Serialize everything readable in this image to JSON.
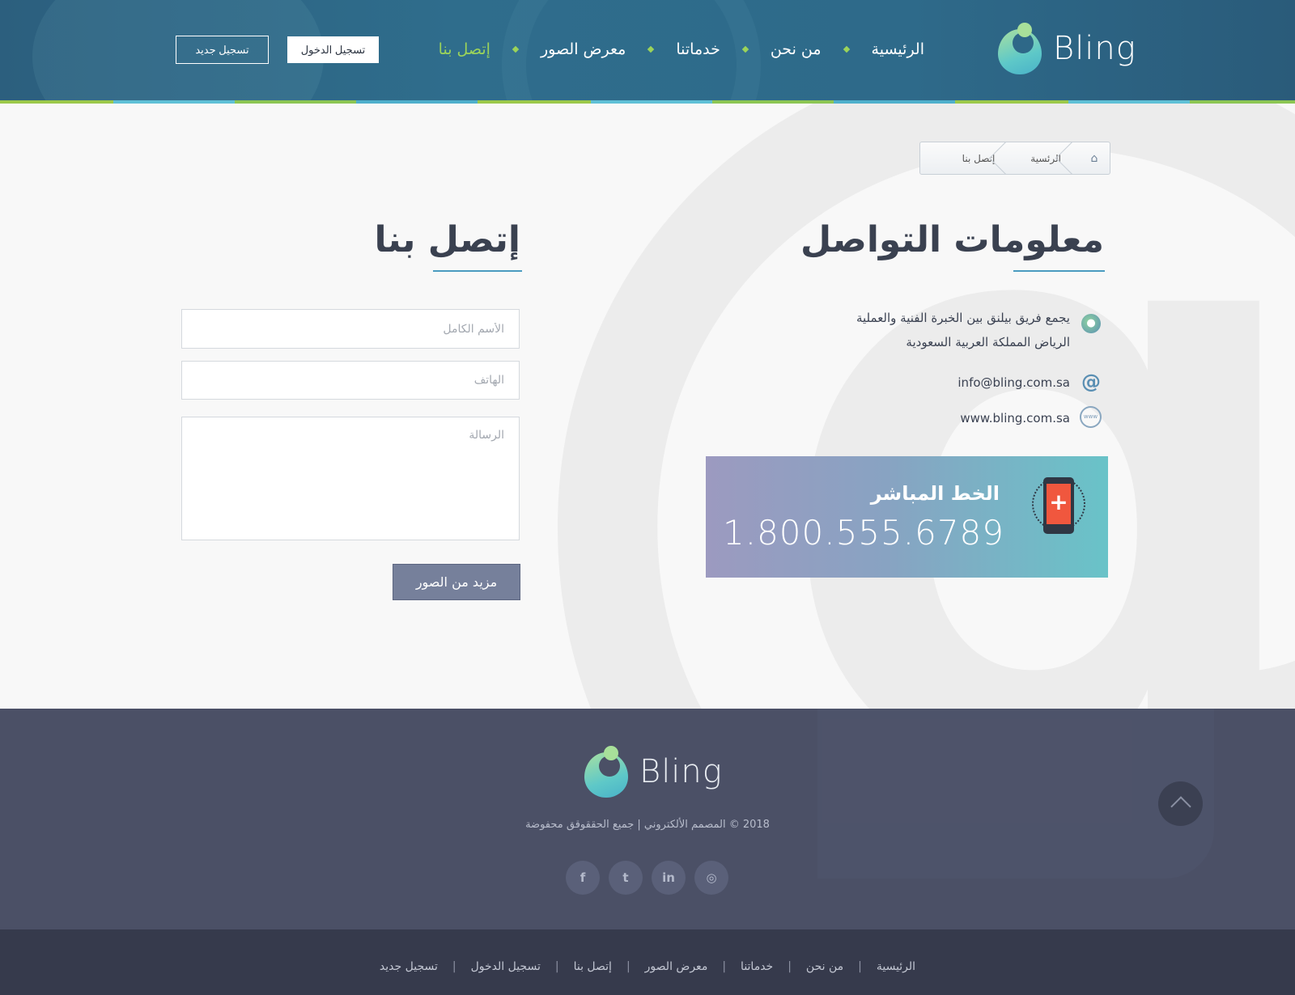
{
  "header": {
    "logo_text": "Bling",
    "nav": [
      "الرئيسية",
      "من نحن",
      "خدماتنا",
      "معرض الصور",
      "إتصل بنا"
    ],
    "active_nav": "إتصل بنا",
    "login_label": "تسجيل الدخول",
    "register_label": "تسجيل جديد",
    "accent_color": "#9bd35a"
  },
  "breadcrumb": {
    "home_icon": "home-icon",
    "items": [
      "الرئسية",
      "إتصل بنا"
    ]
  },
  "contact_info": {
    "title": "معلومات التواصل",
    "address_line1": "يجمع فريق بيلنق بين الخبرة الفنية والعملية",
    "address_line2": "الرياض المملكة العربية السعودية",
    "email": "info@bling.com.sa",
    "website": "www.bling.com.sa",
    "hotline_title": "الخط المباشر",
    "hotline_number": "1.800.555.6789"
  },
  "contact_form": {
    "title": "إتصل بنا",
    "name_placeholder": "الأسم الكامل",
    "phone_placeholder": "الهاتف",
    "message_placeholder": "الرسالة",
    "submit_label": "مزيد من الصور"
  },
  "footer": {
    "logo_text": "Bling",
    "copyright": "2018 © المصمم الألكتروني | جميع الحققوقق محفوضة",
    "socials": [
      "facebook-icon",
      "twitter-icon",
      "linkedin-icon",
      "instagram-icon"
    ],
    "social_glyphs": [
      "f",
      "t",
      "in",
      "◎"
    ],
    "bottom_links": [
      "الرئيسية",
      "من نحن",
      "خدماتنا",
      "معرض الصور",
      "إتصل بنا",
      "تسجيل الدخول",
      "تسجيل جديد"
    ]
  }
}
